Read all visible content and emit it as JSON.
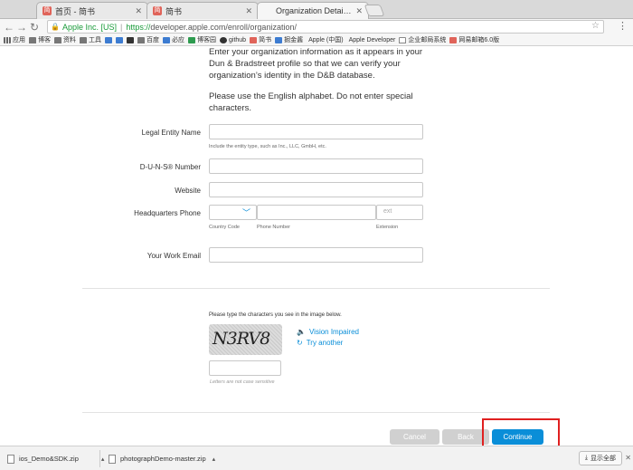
{
  "browser": {
    "tabs": [
      {
        "title": "首页 - 简书",
        "favicon": "jianshu-icon",
        "active": false
      },
      {
        "title": "简书",
        "favicon": "jianshu-icon",
        "active": false
      },
      {
        "title": "Organization Details - Apple D",
        "favicon": "apple-icon",
        "active": true
      }
    ],
    "address": {
      "origin": "Apple Inc. [US]",
      "url_scheme": "https://",
      "url_rest": "developer.apple.com/enroll/organization/"
    },
    "bookmarks": [
      {
        "label": "应用",
        "icon": "apps-grid-icon"
      },
      {
        "label": "博客",
        "icon": "folder-icon"
      },
      {
        "label": "资料",
        "icon": "folder-icon"
      },
      {
        "label": "工具",
        "icon": "folder-icon"
      },
      {
        "label": "",
        "icon": "vscode-icon"
      },
      {
        "label": "",
        "icon": "a-icon"
      },
      {
        "label": "",
        "icon": "c-icon"
      },
      {
        "label": "百度",
        "icon": "folder-icon"
      },
      {
        "label": "必应",
        "icon": "bing-icon"
      },
      {
        "label": "博客园",
        "icon": "cnblogs-icon"
      },
      {
        "label": "github",
        "icon": "github-icon"
      },
      {
        "label": "简书",
        "icon": "jianshu-icon"
      },
      {
        "label": "掘金酱",
        "icon": "juejin-icon"
      },
      {
        "label": "Apple (中国)",
        "icon": "apple-icon"
      },
      {
        "label": "Apple Developer",
        "icon": "apple-icon"
      },
      {
        "label": "企业邮局系统",
        "icon": "mail-icon"
      },
      {
        "label": "网易邮箱6.0版",
        "icon": "netease-icon"
      }
    ]
  },
  "form": {
    "intro_1": "Enter your organization information as it appears in your Dun & Bradstreet profile so that we can verify your organization’s identity in the D&B database.",
    "intro_2": "Please use the English alphabet. Do not enter special characters.",
    "legal_entity_label": "Legal Entity Name",
    "legal_entity_hint": "Include the entity type, such as Inc., LLC, GmbH, etc.",
    "duns_label": "D-U-N-S® Number",
    "website_label": "Website",
    "hq_phone_label": "Headquarters Phone",
    "country_code_hint": "Country Code",
    "phone_number_hint": "Phone Number",
    "extension_hint": "Extension",
    "ext_placeholder": "ext",
    "email_label": "Your Work Email",
    "captcha_prompt": "Please type the characters you see in the image below.",
    "captcha_text": "N3RV8",
    "vision_impaired": "Vision Impaired",
    "try_another": "Try another",
    "captcha_hint": "Letters are not case sensitive",
    "cancel": "Cancel",
    "back": "Back",
    "continue": "Continue"
  },
  "downloads": {
    "items": [
      {
        "name": "ios_Demo&SDK.zip"
      },
      {
        "name": "photographDemo-master.zip"
      }
    ],
    "show_all": "显示全部"
  },
  "colors": {
    "accent": "#0a8ed8",
    "highlight": "#e02020",
    "secure": "#1a9b3a"
  }
}
